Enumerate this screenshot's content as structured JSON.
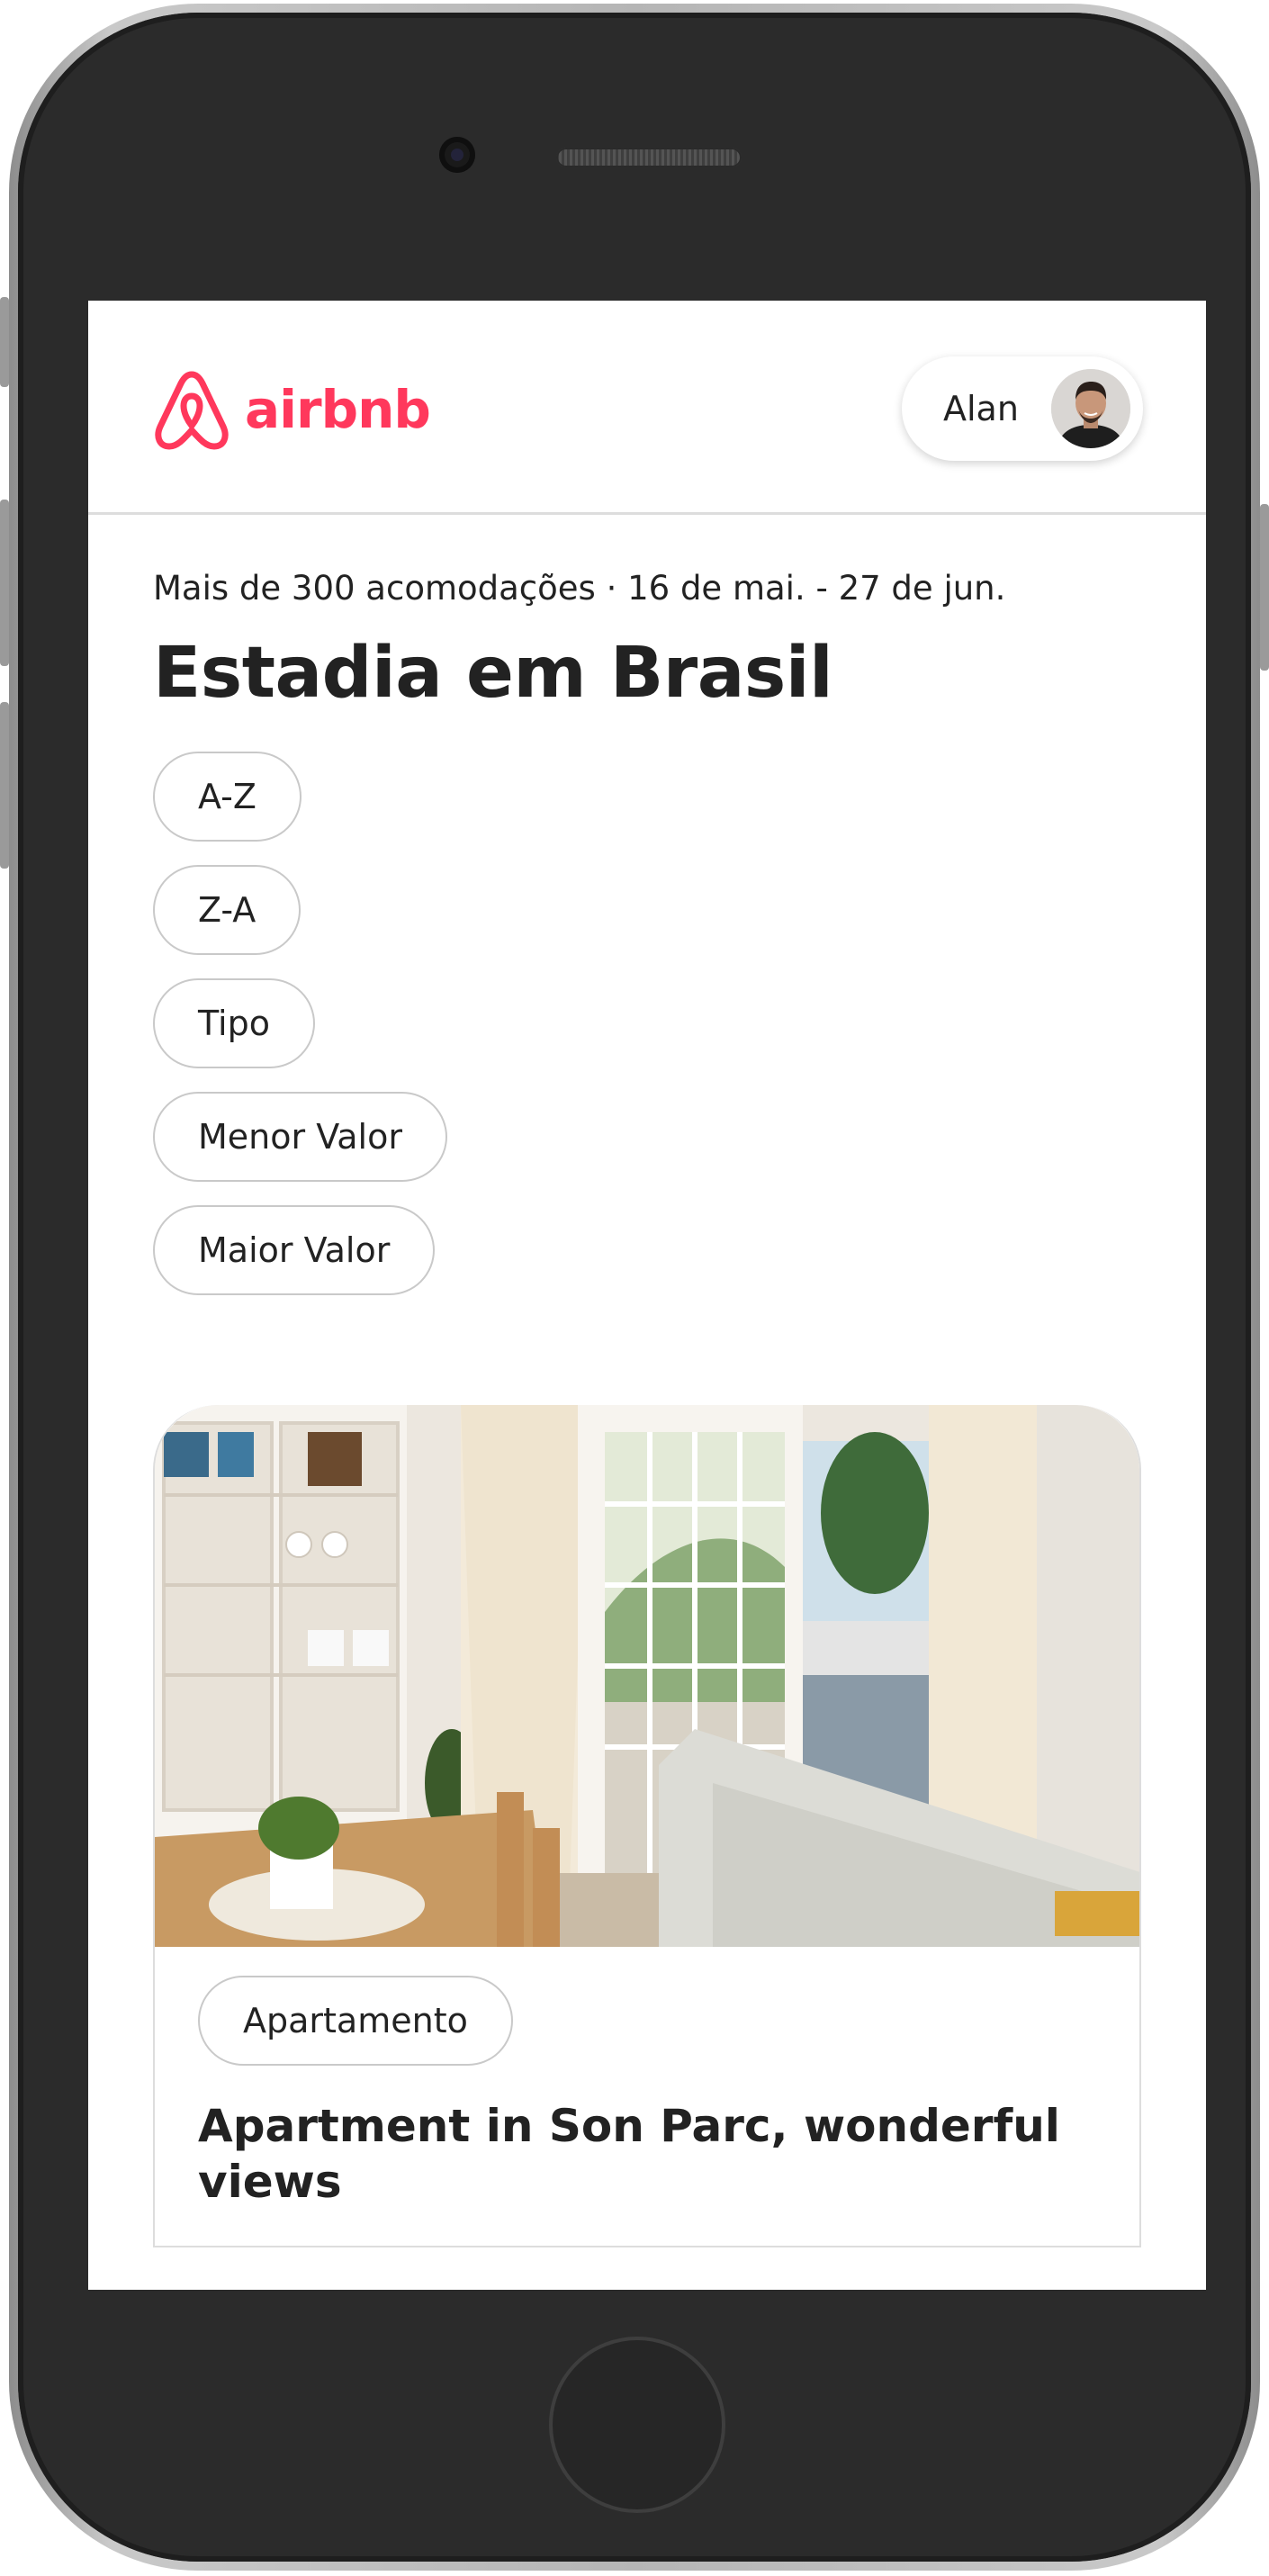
{
  "header": {
    "logo_text": "airbnb",
    "user_name": "Alan"
  },
  "main": {
    "meta": "Mais de 300 acomodações · 16 de mai. - 27 de jun.",
    "title": "Estadia em Brasil",
    "filters": [
      "A-Z",
      "Z-A",
      "Tipo",
      "Menor Valor",
      "Maior Valor"
    ]
  },
  "listing": {
    "type": "Apartamento",
    "title": "Apartment in Son Parc, wonderful views"
  },
  "colors": {
    "brand": "#ff385c",
    "text": "#222222",
    "border": "#dddddd",
    "device": "#2b2b2b"
  },
  "icons": {
    "logo": "airbnb-logo-icon",
    "avatar": "user-avatar"
  }
}
